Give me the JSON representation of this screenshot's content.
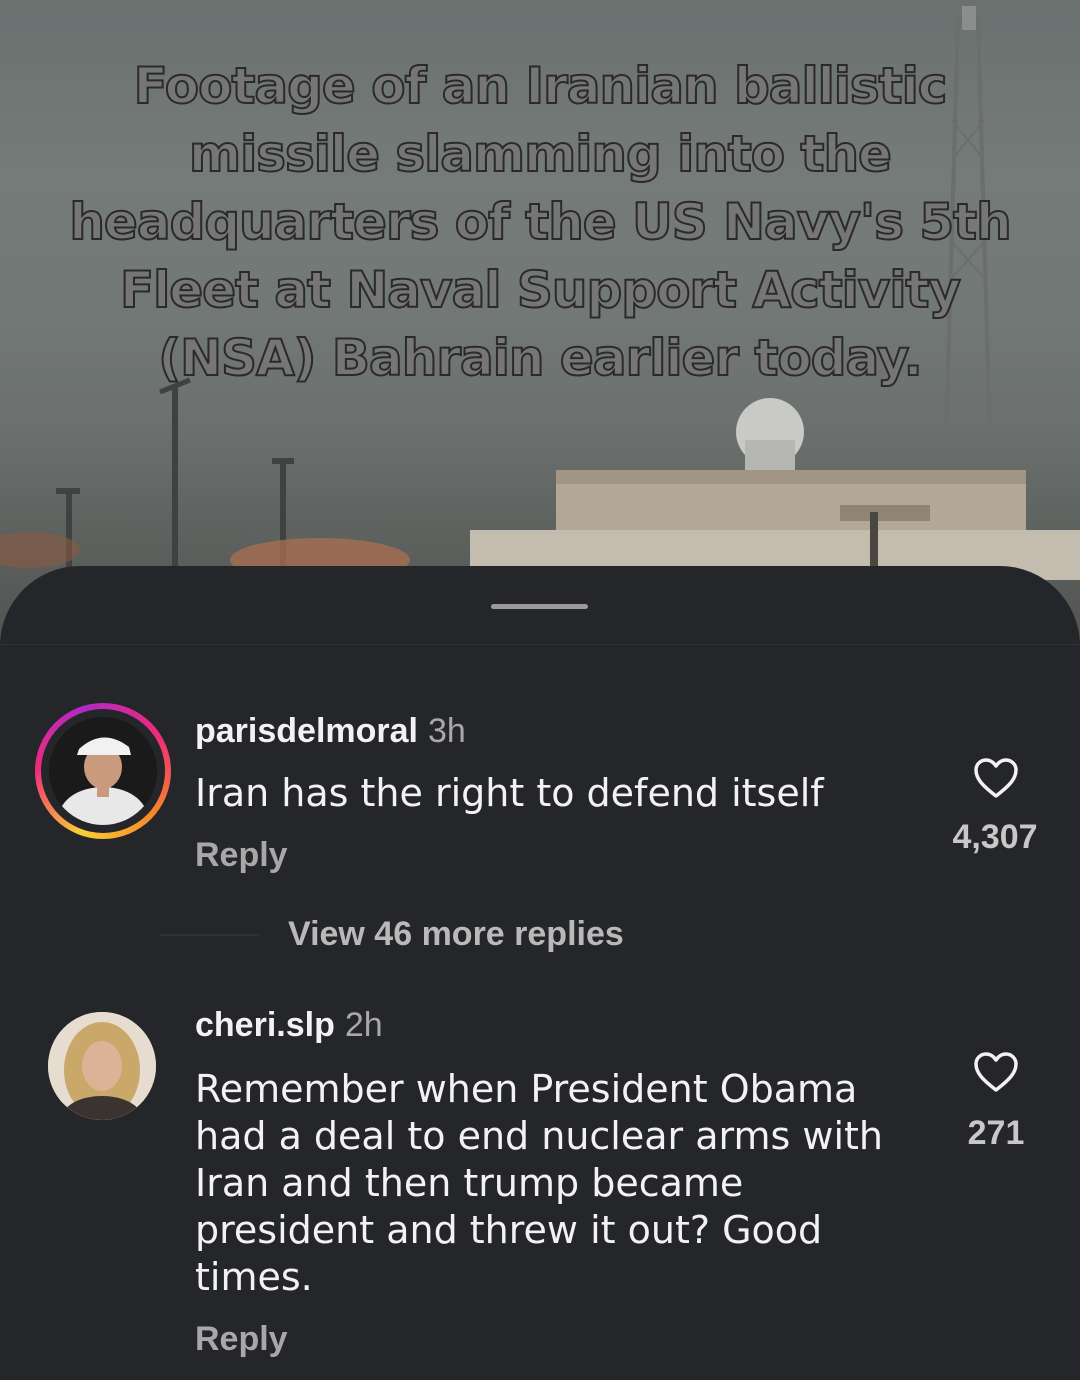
{
  "video": {
    "caption": "Footage of an Iranian ballistic missile slamming into the headquarters of the US Navy's 5th Fleet at Naval Support Activity (NSA) Bahrain earlier today."
  },
  "comments": [
    {
      "username": "parisdelmoral",
      "time": "3h",
      "text": "Iran has the right to defend itself",
      "reply_label": "Reply",
      "likes": "4,307",
      "has_story_ring": true
    },
    {
      "username": "cheri.slp",
      "time": "2h",
      "text": "Remember when President Obama had a deal to end nuclear arms with Iran and then trump became president and threw it out?  Good times.",
      "reply_label": "Reply",
      "likes": "271",
      "has_story_ring": false
    }
  ],
  "thread": {
    "view_more_label": "View 46 more replies"
  },
  "icons": {
    "like": "heart-outline-icon"
  },
  "colors": {
    "sheet_background": "#25262a",
    "primary_text": "#f2f2f2",
    "secondary_text": "#a8a8a8"
  }
}
